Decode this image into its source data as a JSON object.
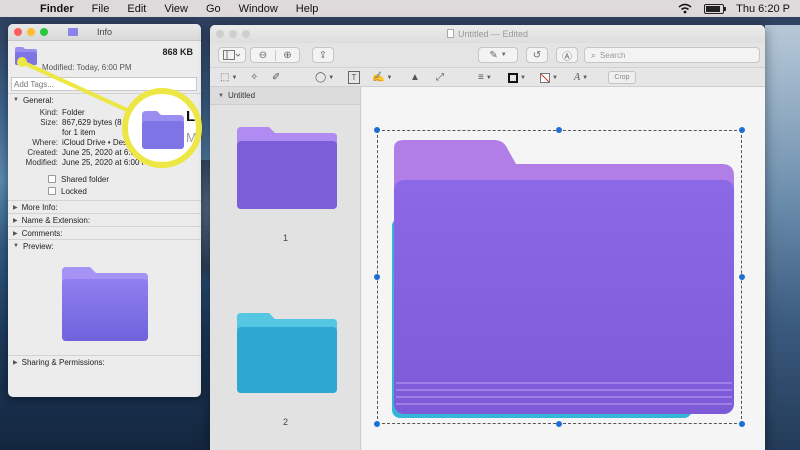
{
  "menubar": {
    "apple": "",
    "items": [
      "Finder",
      "File",
      "Edit",
      "View",
      "Go",
      "Window",
      "Help"
    ],
    "clock": "Thu 6:20 P",
    "battery_level": 0.9
  },
  "info_window": {
    "title": "Info",
    "size_bold": "868 KB",
    "modified_short": "Modified: Today, 6:00 PM",
    "tags_placeholder": "Add Tags...",
    "general_label": "General:",
    "fields": [
      {
        "k": "Kind:",
        "v": "Folder"
      },
      {
        "k": "Size:",
        "v": "867,629 bytes (8"
      },
      {
        "k": "",
        "v": "for 1 item"
      },
      {
        "k": "Where:",
        "v": "iCloud Drive • Deskt"
      },
      {
        "k": "Created:",
        "v": "June 25, 2020 at 6:00 PM"
      },
      {
        "k": "Modified:",
        "v": "June 25, 2020 at 6:00 PM"
      }
    ],
    "shared_folder": "Shared folder",
    "locked": "Locked",
    "more_info": "More Info:",
    "name_extension": "Name & Extension:",
    "comments": "Comments:",
    "preview": "Preview:",
    "sharing": "Sharing & Permissions:",
    "callout_letter_1": "L",
    "callout_letter_2": "M"
  },
  "preview_window": {
    "title": "Untitled — Edited",
    "title_name": "Untitled",
    "title_edited": "Edited",
    "search_placeholder": "Search",
    "crop_label": "Crop",
    "sidebar_heading": "Untitled",
    "thumbnails": [
      {
        "page": "1",
        "color_top": "#a97ff0",
        "color_bottom": "#7b5fd9"
      },
      {
        "page": "2",
        "color_top": "#4fc8e0",
        "color_bottom": "#2aa5cf"
      }
    ],
    "accent": "#1d6fd6"
  },
  "colors": {
    "highlight": "#ece744",
    "folder_purple": "#8b6ae6",
    "folder_teal": "#33b6d8"
  }
}
